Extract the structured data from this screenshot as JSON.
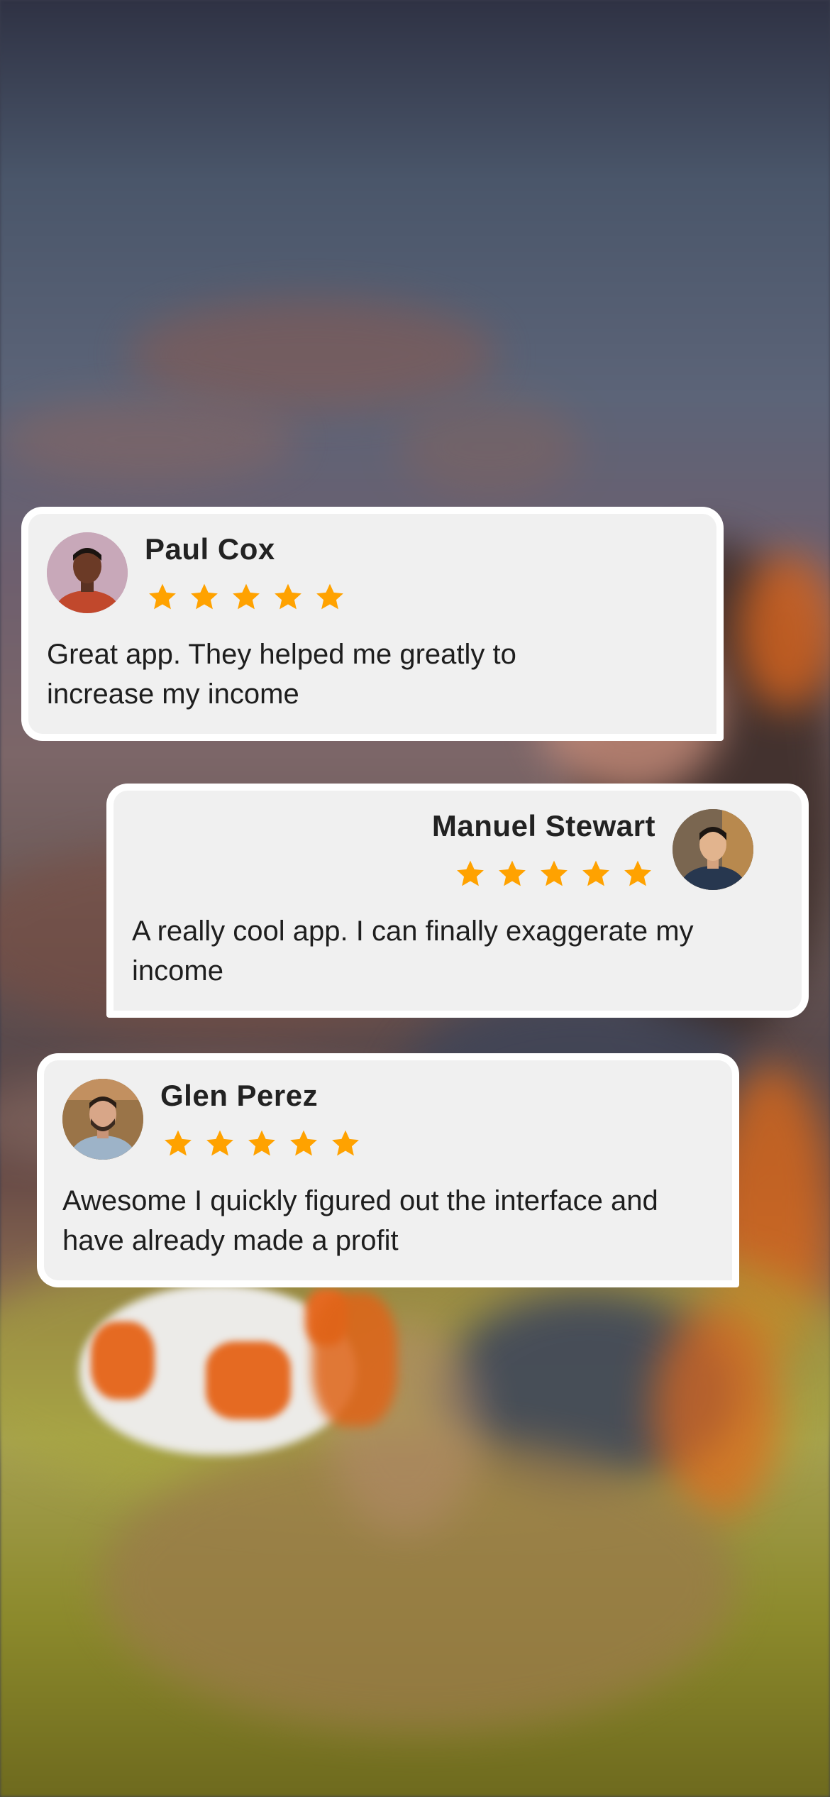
{
  "reviews": [
    {
      "name": "Paul Cox",
      "rating": 5,
      "text": "Great app. They helped me greatly to increase my income",
      "avatar_icon": "person-avatar-icon"
    },
    {
      "name": "Manuel Stewart",
      "rating": 5,
      "text": "A really cool app. I can finally exaggerate my income",
      "avatar_icon": "person-avatar-icon"
    },
    {
      "name": "Glen Perez",
      "rating": 5,
      "text": "Awesome I quickly figured out the interface and have already made a profit",
      "avatar_icon": "person-avatar-icon"
    }
  ],
  "colors": {
    "star": "#FFA200",
    "card_bg": "#F0F0F0",
    "card_border": "#FFFFFF",
    "ball_accent": "#E8671C"
  }
}
